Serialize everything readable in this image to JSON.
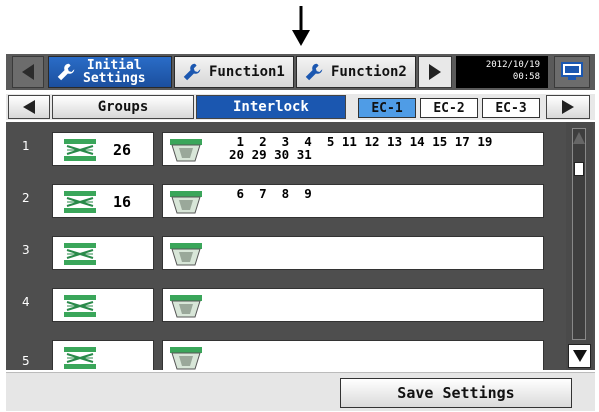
{
  "top_tabs": [
    {
      "label_line1": "Initial",
      "label_line2": "Settings",
      "icon": "wrench-icon",
      "active": true
    },
    {
      "label": "Function1",
      "icon": "wrench-icon",
      "active": false
    },
    {
      "label": "Function2",
      "icon": "wrench-icon",
      "active": false
    }
  ],
  "datetime": {
    "date": "2012/10/19",
    "time": "00:58"
  },
  "sub_tabs": [
    {
      "label": "Groups",
      "active": false
    },
    {
      "label": "Interlock",
      "active": true
    }
  ],
  "ec_buttons": [
    {
      "label": "EC-1",
      "active": true
    },
    {
      "label": "EC-2",
      "active": false
    },
    {
      "label": "EC-3",
      "active": false
    }
  ],
  "rows": [
    {
      "num": "1",
      "group": "26",
      "line1": " 1  2  3  4  5 11 12 13 14 15 17 19",
      "line2": "20 29 30 31"
    },
    {
      "num": "2",
      "group": "16",
      "line1": " 6  7  8  9",
      "line2": ""
    },
    {
      "num": "3",
      "group": "",
      "line1": "",
      "line2": ""
    },
    {
      "num": "4",
      "group": "",
      "line1": "",
      "line2": ""
    },
    {
      "num": "5",
      "group": "",
      "line1": "",
      "line2": ""
    }
  ],
  "bottom": {
    "save_label": "Save Settings"
  },
  "colors": {
    "active_tab": "#1b57b0",
    "ec_active": "#4f9ce6",
    "list_bg": "#4e4e4e",
    "icon_green": "#3aa65a"
  }
}
